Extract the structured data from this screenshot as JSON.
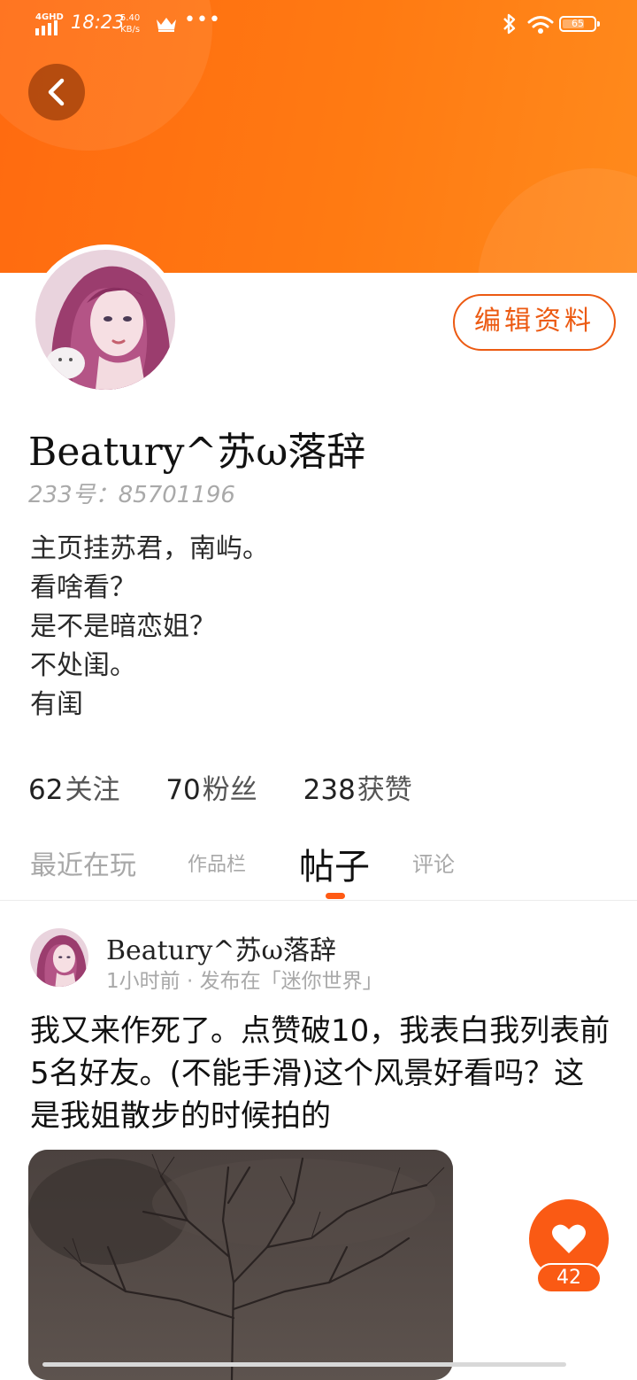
{
  "status_bar": {
    "network": "4GHD",
    "time": "18:23",
    "speed_value": "5.40",
    "speed_unit": "KB/s",
    "more": "•••",
    "battery": "65",
    "icons": [
      "signal-icon",
      "crown-icon",
      "bluetooth-icon",
      "wifi-icon",
      "battery-icon"
    ]
  },
  "header": {
    "back_icon": "chevron-left-icon"
  },
  "profile": {
    "edit_button": "编辑资料",
    "username": "Beatury^苏ω落辞",
    "id_line": "233号：85701196",
    "bio": [
      "主页挂苏君，南屿。",
      "看啥看？",
      "是不是暗恋姐？",
      "不处闺。",
      "有闺"
    ],
    "stats": [
      {
        "value": "62",
        "label": "关注"
      },
      {
        "value": "70",
        "label": "粉丝"
      },
      {
        "value": "238",
        "label": "获赞"
      }
    ]
  },
  "tabs": [
    {
      "label": "最近在玩",
      "active": false
    },
    {
      "label": "作品栏",
      "active": false
    },
    {
      "label": "帖子",
      "active": true
    },
    {
      "label": "评论",
      "active": false
    }
  ],
  "post": {
    "author": "Beatury^苏ω落辞",
    "meta": "1小时前 · 发布在「迷你世界」",
    "text": "我又来作死了。点赞破10，我表白我列表前5名好友。(不能手滑)这个风景好看吗？这是我姐散步的时候拍的",
    "like_count": "42",
    "like_icon": "heart-icon"
  },
  "colors": {
    "accent": "#ff6a10",
    "accent_dark": "#ec5a12",
    "muted": "#a8a8a8"
  }
}
